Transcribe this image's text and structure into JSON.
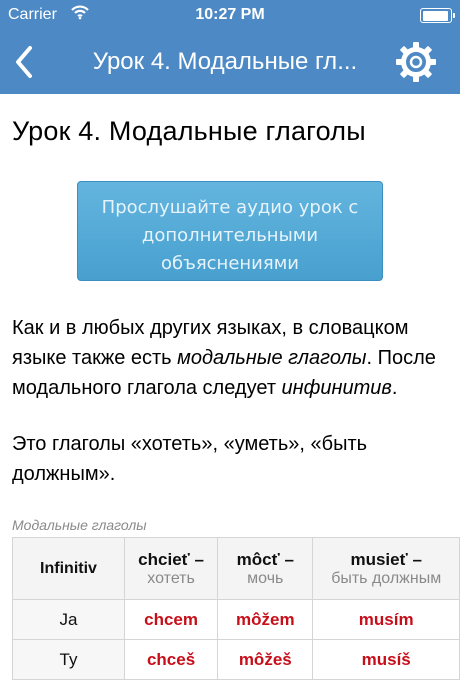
{
  "status_bar": {
    "carrier": "Carrier",
    "time": "10:27 PM",
    "battery_level": 0.95
  },
  "nav_bar": {
    "title": "Урок 4. Модальные гл...",
    "back_icon": "chevron-left-icon",
    "settings_icon": "gear-icon",
    "color": "#4d89c4"
  },
  "lesson": {
    "heading": "Урок 4. Модальные глаголы",
    "audio_button": {
      "line1": "Прослушайте аудио урок с",
      "line2": "дополнительными",
      "line3": "объяснениями"
    },
    "para1": {
      "before": "Как и в любых других языках, в словацком языке также есть ",
      "em1": "модальные глаголы",
      "middle": ". После модального глагола следует ",
      "em2": "инфинитив",
      "after": "."
    },
    "para2": "Это глаголы «хотеть», «уметь», «быть должным».",
    "table_caption": "Модальные глаголы",
    "table": {
      "header_label": "Infinitiv",
      "columns": [
        {
          "verb": "chcieť",
          "dash": " –",
          "translation": "хотеть"
        },
        {
          "verb": "môcť",
          "dash": " –",
          "translation": "мочь"
        },
        {
          "verb": "musieť",
          "dash": " –",
          "translation": "быть должным"
        }
      ],
      "rows": [
        {
          "person": "Ja",
          "forms": [
            "chcem",
            "môžem",
            "musím"
          ]
        },
        {
          "person": "Ty",
          "forms": [
            "chceš",
            "môžeš",
            "musíš"
          ]
        }
      ],
      "form_color": "#c70f1a"
    }
  }
}
